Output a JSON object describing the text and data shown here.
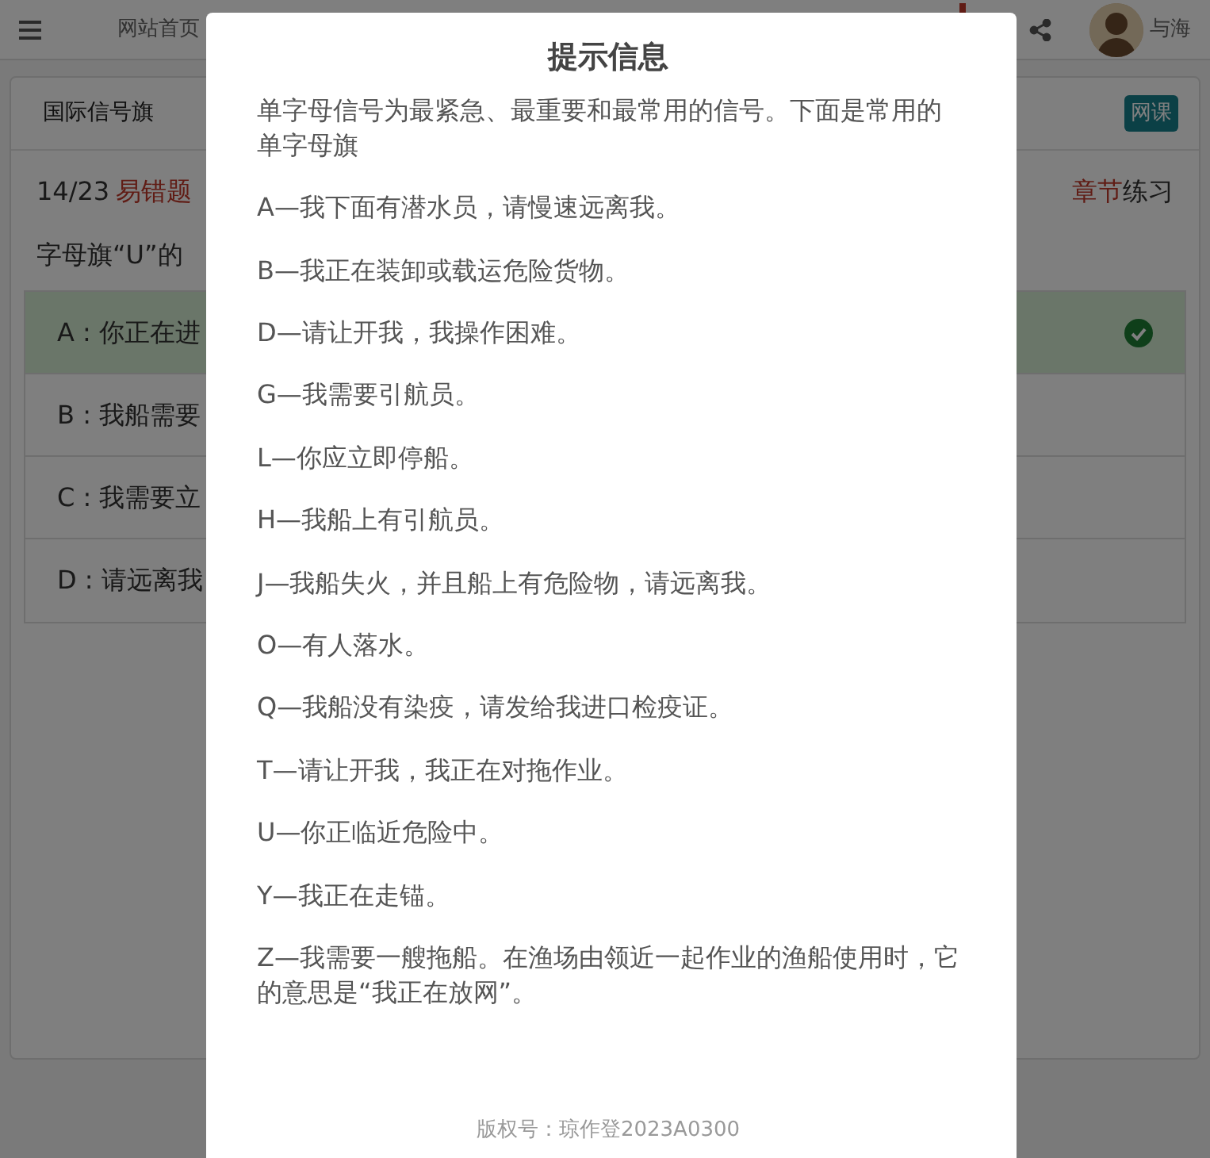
{
  "navbar": {
    "home_link": "网站首页",
    "user_name": "与海"
  },
  "card": {
    "title": "国际信号旗",
    "course_button": "网课",
    "progress": "14/23",
    "tag": "易错题",
    "chapter_prefix": "章节",
    "chapter_suffix": "练习",
    "question": "字母旗“U”的",
    "options": [
      {
        "text": "A : 你正在进",
        "selected": true
      },
      {
        "text": "B : 我船需要",
        "selected": false
      },
      {
        "text": "C : 我需要立",
        "selected": false
      },
      {
        "text": "D : 请远离我",
        "selected": false
      }
    ]
  },
  "modal": {
    "title": "提示信息",
    "intro": "单字母信号为最紧急、最重要和最常用的信号。下面是常用的单字母旗",
    "items": [
      "A—我下面有潜水员，请慢速远离我。",
      "B—我正在装卸或载运危险货物。",
      "D—请让开我，我操作困难。",
      "G—我需要引航员。",
      "L—你应立即停船。",
      "H—我船上有引航员。",
      "J—我船失火，并且船上有危险物，请远离我。",
      "O—有人落水。",
      "Q—我船没有染疫，请发给我进口检疫证。",
      "T—请让开我，我正在对拖作业。",
      "U—你正临近危险中。",
      "Y—我正在走锚。",
      "Z—我需要一艘拖船。在渔场由领近一起作业的渔船使用时，它的意思是“我正在放网”。"
    ],
    "copyright": "版权号：琼作登2023A0300"
  }
}
